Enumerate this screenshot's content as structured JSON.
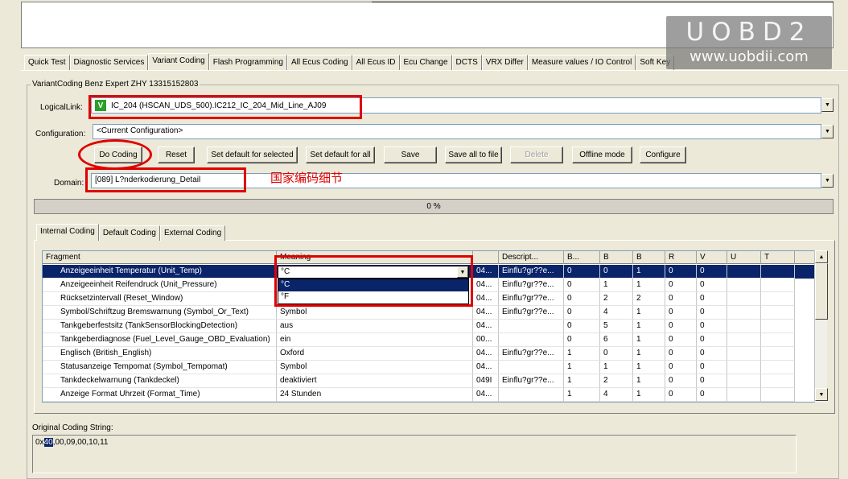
{
  "watermark": {
    "logo": "UOBD2",
    "url": "www.uobdii.com"
  },
  "tabs": [
    "Quick Test",
    "Diagnostic Services",
    "Variant Coding",
    "Flash Programming",
    "All Ecus Coding",
    "All Ecus ID",
    "Ecu Change",
    "DCTS",
    "VRX Differ",
    "Measure values / IO Control",
    "Soft Key"
  ],
  "active_tab": "Variant Coding",
  "group_title": "VariantCoding Benz Expert ZHY 13315152803",
  "logical_link": {
    "label": "LogicalLink:",
    "badge": "V",
    "value": "IC_204 (HSCAN_UDS_500).IC212_IC_204_Mid_Line_AJ09"
  },
  "configuration": {
    "label": "Configuration:",
    "value": "<Current Configuration>"
  },
  "buttons": {
    "do_coding": "Do Coding",
    "reset": "Reset",
    "set_default_selected": "Set default for selected",
    "set_default_all": "Set default for all",
    "save": "Save",
    "save_all": "Save all to file",
    "delete": "Delete",
    "offline": "Offline mode",
    "configure": "Configure"
  },
  "domain": {
    "label": "Domain:",
    "value": "[089] L?nderkodierung_Detail"
  },
  "annotation": "国家编码细节",
  "progress": {
    "text": "0 %",
    "value": 0
  },
  "inner_tabs": [
    "Internal Coding",
    "Default Coding",
    "External Coding"
  ],
  "grid": {
    "columns": [
      "Fragment",
      "Meaning",
      "",
      "Descript...",
      "B...",
      "B",
      "B",
      "R",
      "V",
      "U",
      "T"
    ],
    "rows": [
      [
        "Anzeigeeinheit Temperatur (Unit_Temp)",
        "°C",
        "04...",
        "Einflu?gr??e...",
        "0",
        "0",
        "1",
        "0",
        "0"
      ],
      [
        "Anzeigeeinheit Reifendruck (Unit_Pressure)",
        "",
        "04...",
        "Einflu?gr??e...",
        "0",
        "1",
        "1",
        "0",
        "0"
      ],
      [
        "Rücksetzintervall (Reset_Window)",
        "",
        "04...",
        "Einflu?gr??e...",
        "0",
        "2",
        "2",
        "0",
        "0"
      ],
      [
        "Symbol/Schriftzug Bremswarnung (Symbol_Or_Text)",
        "Symbol",
        "04...",
        "Einflu?gr??e...",
        "0",
        "4",
        "1",
        "0",
        "0"
      ],
      [
        "Tankgeberfestsitz (TankSensorBlockingDetection)",
        "aus",
        "04...",
        "",
        "0",
        "5",
        "1",
        "0",
        "0"
      ],
      [
        "Tankgeberdiagnose (Fuel_Level_Gauge_OBD_Evaluation)",
        "ein",
        "00...",
        "",
        "0",
        "6",
        "1",
        "0",
        "0"
      ],
      [
        "Englisch (British_English)",
        "Oxford",
        "04...",
        "Einflu?gr??e...",
        "1",
        "0",
        "1",
        "0",
        "0"
      ],
      [
        "Statusanzeige Tempomat (Symbol_Tempomat)",
        "Symbol",
        "04...",
        "",
        "1",
        "1",
        "1",
        "0",
        "0"
      ],
      [
        "Tankdeckelwarnung (Tankdeckel)",
        "deaktiviert",
        "049I",
        "Einflu?gr??e...",
        "1",
        "2",
        "1",
        "0",
        "0"
      ],
      [
        "Anzeige Format Uhrzeit (Format_Time)",
        "24 Stunden",
        "04...",
        "",
        "1",
        "4",
        "1",
        "0",
        "0"
      ]
    ]
  },
  "inline_combo": {
    "value": "°C",
    "options": [
      "°C",
      "°F"
    ],
    "selected": "°C"
  },
  "original_coding": {
    "label": "Original Coding String:",
    "prefix": "0x",
    "highlight": "40",
    "rest": ",00,09,00,10,11"
  },
  "colors": {
    "selection": "#0a246a",
    "annotation_red": "#e00000",
    "window_bg": "#ece9d8"
  }
}
